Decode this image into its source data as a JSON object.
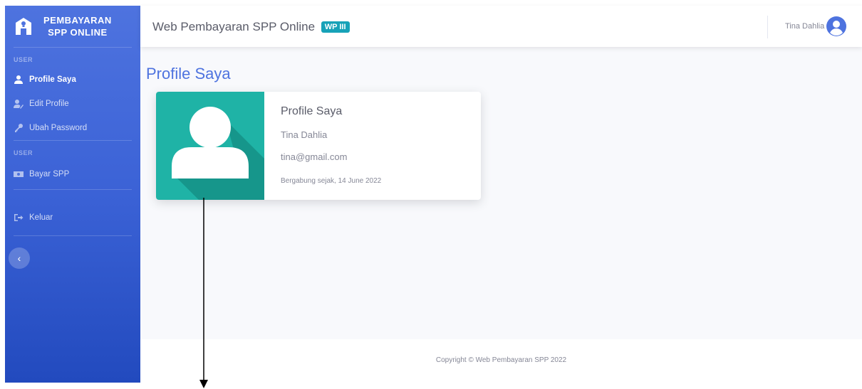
{
  "brand": {
    "line1": "PEMBAYARAN",
    "line2": "SPP ONLINE"
  },
  "sidebar": {
    "sections": [
      {
        "heading": "USER",
        "items": [
          {
            "label": "Profile Saya",
            "icon": "user-icon",
            "active": true
          },
          {
            "label": "Edit Profile",
            "icon": "user-edit-icon",
            "active": false
          },
          {
            "label": "Ubah Password",
            "icon": "key-icon",
            "active": false
          }
        ]
      },
      {
        "heading": "USER",
        "items": [
          {
            "label": "Bayar SPP",
            "icon": "money-icon",
            "active": false
          }
        ]
      }
    ],
    "logout": {
      "label": "Keluar",
      "icon": "sign-out-icon"
    },
    "toggle": {
      "icon": "chevron-left-icon",
      "glyph": "‹"
    }
  },
  "topbar": {
    "title": "Web Pembayaran SPP Online",
    "badge": "WP III",
    "user_name": "Tina Dahlia",
    "avatar_icon": "user-circle-icon"
  },
  "page": {
    "title": "Profile Saya"
  },
  "profile_card": {
    "title": "Profile Saya",
    "name": "Tina Dahlia",
    "email": "tina@gmail.com",
    "joined": "Bergabung sejak, 14 June 2022",
    "image_icon": "user-avatar-icon"
  },
  "footer": {
    "text": "Copyright © Web Pembayaran SPP 2022"
  },
  "colors": {
    "primary": "#4e73df",
    "primary_dark": "#224abe",
    "teal": "#1fb3a6",
    "badge": "#17a2b8"
  }
}
